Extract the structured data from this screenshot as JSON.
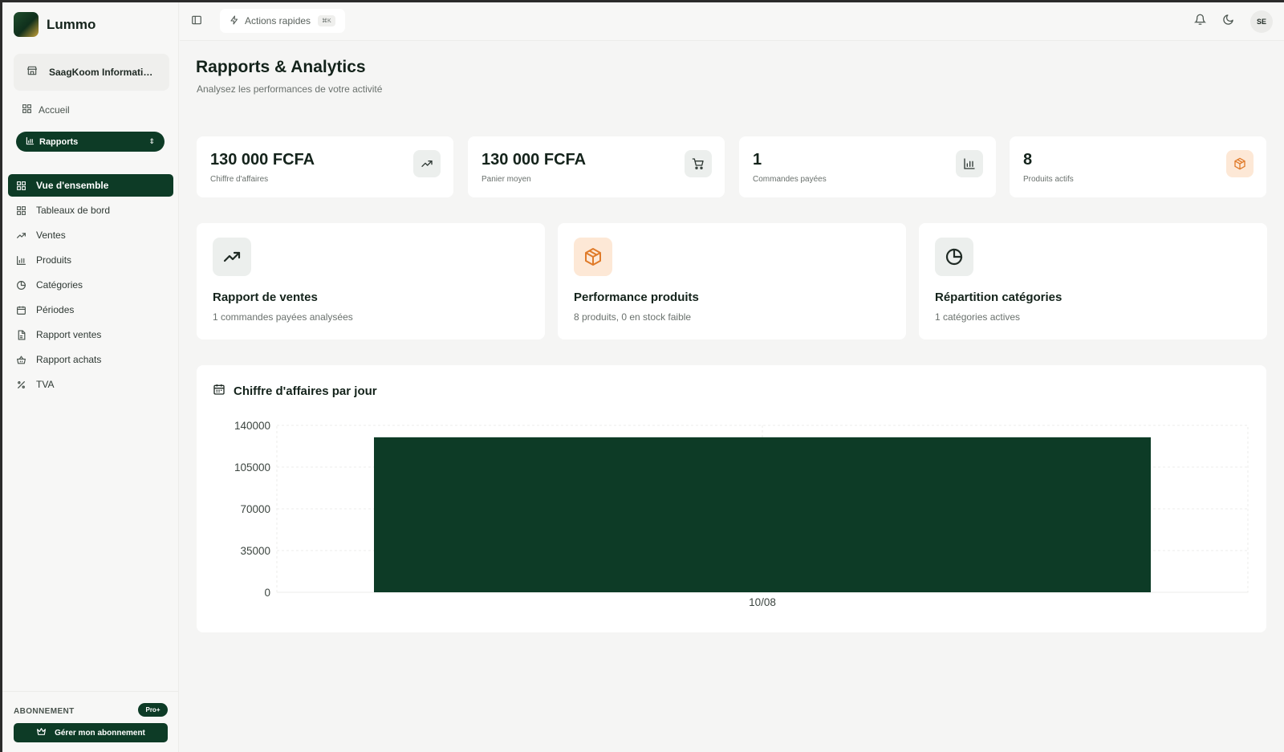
{
  "app": {
    "name": "Lummo"
  },
  "organization": {
    "name": "SaagKoom Informatique"
  },
  "nav": {
    "home_label": "Accueil",
    "section_label": "Rapports",
    "items": [
      {
        "label": "Vue d'ensemble",
        "icon": "grid-icon",
        "active": true
      },
      {
        "label": "Tableaux de bord",
        "icon": "grid-icon",
        "active": false
      },
      {
        "label": "Ventes",
        "icon": "trending-up-icon",
        "active": false
      },
      {
        "label": "Produits",
        "icon": "bar-chart-icon",
        "active": false
      },
      {
        "label": "Catégories",
        "icon": "pie-chart-icon",
        "active": false
      },
      {
        "label": "Périodes",
        "icon": "calendar-icon",
        "active": false
      },
      {
        "label": "Rapport ventes",
        "icon": "document-icon",
        "active": false
      },
      {
        "label": "Rapport achats",
        "icon": "basket-icon",
        "active": false
      },
      {
        "label": "TVA",
        "icon": "percent-icon",
        "active": false
      }
    ]
  },
  "subscription": {
    "label": "ABONNEMENT",
    "badge": "Pro+",
    "manage_label": "Gérer mon abonnement"
  },
  "topbar": {
    "quick_actions_label": "Actions rapides",
    "shortcut": "⌘K",
    "avatar_initials": "SE"
  },
  "header": {
    "title": "Rapports & Analytics",
    "subtitle": "Analysez les performances de votre activité"
  },
  "stats": [
    {
      "value": "130 000 FCFA",
      "label": "Chiffre d'affaires",
      "icon": "trending-up-icon"
    },
    {
      "value": "130 000 FCFA",
      "label": "Panier moyen",
      "icon": "cart-icon"
    },
    {
      "value": "1",
      "label": "Commandes payées",
      "icon": "bar-chart-icon"
    },
    {
      "value": "8",
      "label": "Produits actifs",
      "icon": "package-icon"
    }
  ],
  "reports": [
    {
      "title": "Rapport de ventes",
      "subtitle": "1 commandes payées analysées",
      "icon": "trending-up-icon"
    },
    {
      "title": "Performance produits",
      "subtitle": "8 produits, 0 en stock faible",
      "icon": "package-icon"
    },
    {
      "title": "Répartition catégories",
      "subtitle": "1 catégories actives",
      "icon": "pie-chart-icon"
    }
  ],
  "colors": {
    "primary": "#0d3b26",
    "accent_orange": "#e07b2a"
  },
  "chart_data": {
    "type": "bar",
    "title": "Chiffre d'affaires par jour",
    "categories": [
      "10/08"
    ],
    "values": [
      130000
    ],
    "ylim": [
      0,
      140000
    ],
    "yticks": [
      0,
      35000,
      70000,
      105000,
      140000
    ],
    "xlabel": "",
    "ylabel": "",
    "grid": true,
    "bar_color": "#0d3b26"
  }
}
